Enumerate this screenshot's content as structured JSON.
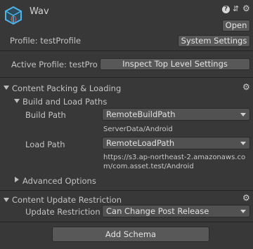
{
  "header": {
    "title": "Wav",
    "open_label": "Open",
    "help_icon": "?",
    "preset_icon": "⇵",
    "settings_icon": "⚙"
  },
  "profile": {
    "label": "Profile: testProfile",
    "settings_button": "System Settings",
    "active_label": "Active Profile: testPro",
    "inspect_button": "Inspect Top Level Settings"
  },
  "content_packing": {
    "title": "Content Packing & Loading",
    "build_load_title": "Build and Load Paths",
    "build_path_label": "Build Path",
    "build_path_value": "RemoteBuildPath",
    "build_path_resolved": "ServerData/Android",
    "load_path_label": "Load Path",
    "load_path_value": "RemoteLoadPath",
    "load_path_resolved_line1": "https://s3.ap-northeast-2.amazonaws.co",
    "load_path_resolved_line2": "m/com.asset.test/Android",
    "advanced_label": "Advanced Options"
  },
  "content_update": {
    "title": "Content Update Restriction",
    "restriction_label": "Update Restriction",
    "restriction_value": "Can Change Post Release"
  },
  "footer": {
    "add_schema_button": "Add Schema"
  },
  "colors": {
    "background": "#383838",
    "icon_border": "#4fb3e8",
    "icon_accent": "#e8644a"
  }
}
